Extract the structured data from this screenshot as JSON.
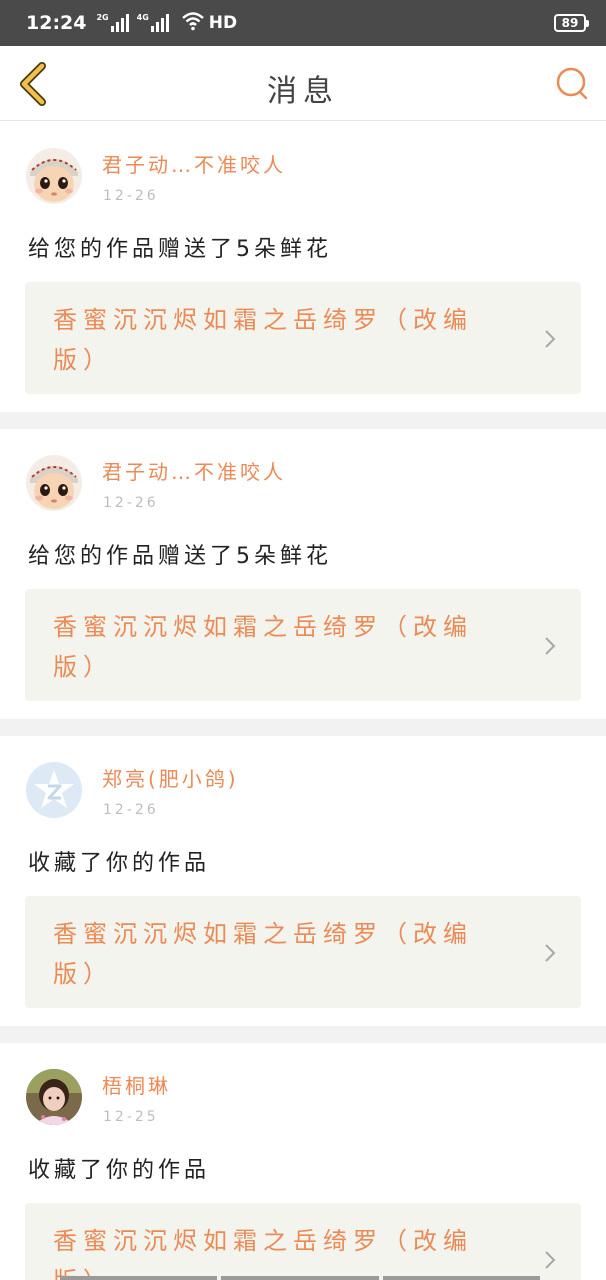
{
  "status_bar": {
    "time": "12:24",
    "signal1_label": "2G",
    "signal2_label": "4G",
    "network": "HD",
    "battery": "89"
  },
  "header": {
    "title": "消息",
    "back_icon": "chevron-left-icon",
    "search_icon": "search-icon"
  },
  "colors": {
    "accent": "#ec8a55",
    "back_icon": "#e8b33a",
    "card_bg": "#f4f4ee"
  },
  "messages": [
    {
      "user": "君子动…不准咬人",
      "date": "12-26",
      "text": "给您的作品赠送了5朵鲜花",
      "work_title": "香蜜沉沉烬如霜之岳绮罗（改编版）",
      "avatar": "doll-avatar"
    },
    {
      "user": "君子动…不准咬人",
      "date": "12-26",
      "text": "给您的作品赠送了5朵鲜花",
      "work_title": "香蜜沉沉烬如霜之岳绮罗（改编版）",
      "avatar": "doll-avatar"
    },
    {
      "user": "郑亮(肥小鸽)",
      "date": "12-26",
      "text": "收藏了你的作品",
      "work_title": "香蜜沉沉烬如霜之岳绮罗（改编版）",
      "avatar": "default-avatar"
    },
    {
      "user": "梧桐琳",
      "date": "12-25",
      "text": "收藏了你的作品",
      "work_title": "香蜜沉沉烬如霜之岳绮罗（改编版）",
      "avatar": "photo-avatar"
    }
  ]
}
